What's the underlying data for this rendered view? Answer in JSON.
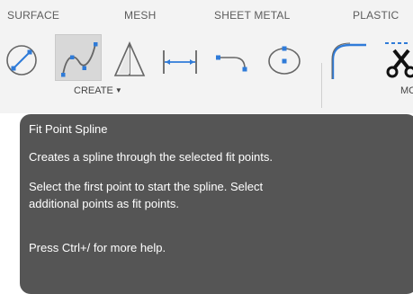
{
  "tabs": {
    "surface": "SURFACE",
    "mesh": "MESH",
    "sheet_metal": "SHEET METAL",
    "plastic": "PLASTIC"
  },
  "tools": [
    {
      "icon": "two-point-line-icon"
    },
    {
      "icon": "fit-point-spline-icon",
      "active": true
    },
    {
      "icon": "triangle-mesh-icon"
    },
    {
      "icon": "dimension-line-icon"
    },
    {
      "icon": "arc-icon"
    },
    {
      "icon": "circle-icon"
    },
    {
      "icon": "fillet-icon"
    },
    {
      "icon": "scissors-icon"
    }
  ],
  "groups": {
    "create_label": "CREATE",
    "create_caret": "▼",
    "modify_partial": "MC"
  },
  "tooltip": {
    "title": "Fit Point Spline",
    "description": "Creates a spline through the selected fit points.",
    "instruction_line1": "Select the first point to start the spline. Select",
    "instruction_line2": "additional points as fit points.",
    "help": "Press Ctrl+/ for more help."
  },
  "colors": {
    "toolbar_bg": "#f3f3f3",
    "tooltip_bg": "#555555",
    "icon_blue": "#2f7bd8",
    "icon_gray": "#666666",
    "tab_text": "#5c5c5c"
  }
}
